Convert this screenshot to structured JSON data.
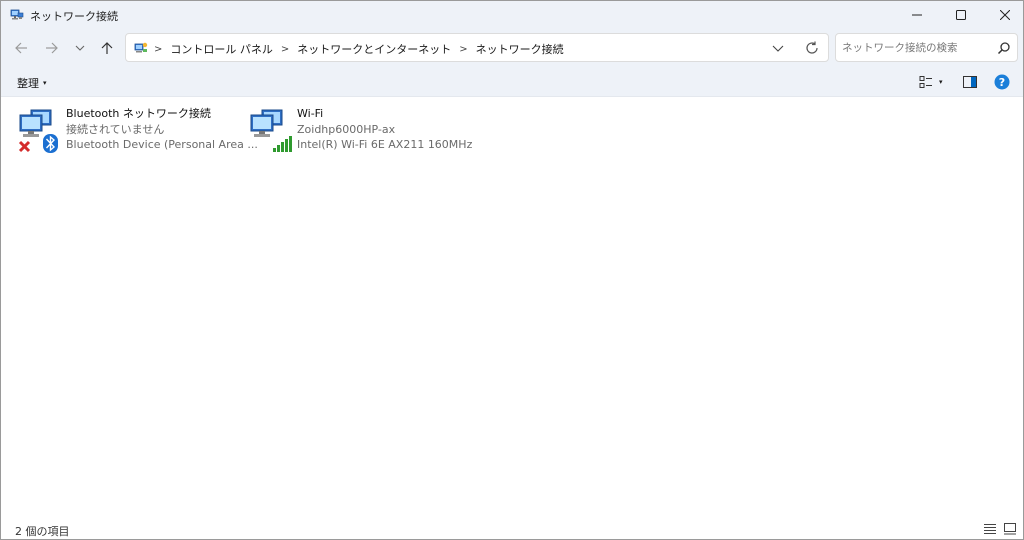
{
  "window": {
    "title": "ネットワーク接続",
    "icons": {
      "app": "network-connections-icon",
      "minimize": "minimize-icon",
      "maximize": "maximize-icon",
      "close": "close-icon"
    }
  },
  "nav": {
    "breadcrumbs": [
      "コントロール パネル",
      "ネットワークとインターネット",
      "ネットワーク接続"
    ],
    "search_placeholder": "ネットワーク接続の検索"
  },
  "commandbar": {
    "organize_label": "整理"
  },
  "items": [
    {
      "name": "Bluetooth ネットワーク接続",
      "status": "接続されていません",
      "device": "Bluetooth Device (Personal Area ...",
      "icon": "bluetooth-network-icon"
    },
    {
      "name": "Wi-Fi",
      "status": "Zoidhp6000HP-ax",
      "device": "Intel(R) Wi-Fi 6E AX211 160MHz",
      "icon": "wifi-network-icon"
    }
  ],
  "statusbar": {
    "count_text": "2 個の項目"
  },
  "colors": {
    "chrome": "#eef2f8",
    "accent": "#0067c0",
    "error": "#d42c2c",
    "signal": "#2f9a2f"
  }
}
